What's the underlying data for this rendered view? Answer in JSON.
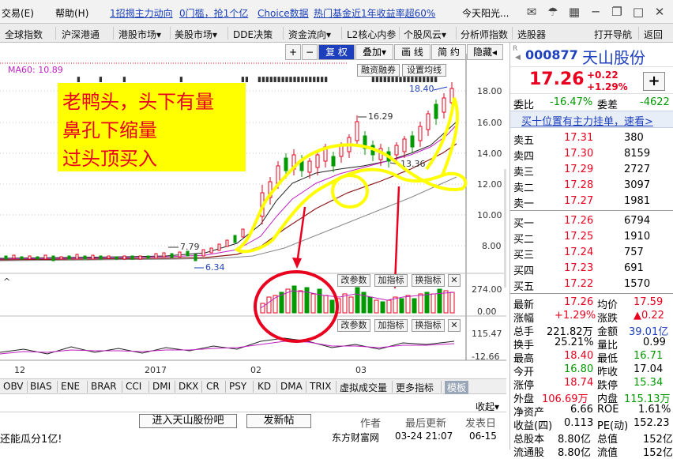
{
  "topbar": {
    "menu_trade": "交易(E)",
    "menu_help": "帮助(H)",
    "links": [
      "1招揭主力动向",
      "0门槛，抢1个亿",
      "Choice数据",
      "热门基金近1年收益率超60%"
    ],
    "weather": "今天阳光..."
  },
  "navbar": {
    "items": [
      "全球指数",
      "沪深港通",
      "港股市场▾",
      "美股市场▾",
      "DDE决策",
      "资金流向▾",
      "L2核心内参",
      "个股风云▾",
      "分析师指数",
      "选股器",
      "打开导航",
      "返回"
    ]
  },
  "chart": {
    "ma_label": "MA60: 10.89",
    "toolbar": [
      "+",
      "−",
      "复 权",
      "叠加▾",
      "画 线",
      "简 约",
      "隐藏◂"
    ],
    "buttons": [
      "融资融券",
      "设置均线"
    ],
    "annotation_lines": [
      "老鸭头，头下有量",
      "鼻孔下缩量",
      "过头顶买入"
    ],
    "price_axis": [
      "18.00",
      "16.00",
      "14.00",
      "12.00",
      "10.00",
      "8.00"
    ],
    "marks": {
      "high": "18.40",
      "p1629": "16.29",
      "p1336": "13.36",
      "p779": "7.79",
      "low": "6.34"
    },
    "indicator_buttons": [
      "改参数",
      "加指标",
      "换指标"
    ],
    "volume_axis": [
      "274.00",
      "0.00"
    ],
    "osc_axis": [
      "115.47",
      "-12.66"
    ],
    "date_labels": [
      "12",
      "2017",
      "02",
      "03"
    ]
  },
  "tabs": {
    "items": [
      "OBV",
      "BIAS",
      "ENE",
      "BRAR",
      "CCI",
      "DMI",
      "DKX",
      "CR",
      "PSY",
      "KD",
      "DMA",
      "TRIX",
      "虚拟成交量",
      "更多指标",
      "模板"
    ]
  },
  "news": {
    "collapse": "收起",
    "btn_forum": "进入天山股份吧",
    "btn_post": "发新帖",
    "headers": [
      "作者",
      "最后更新",
      "发表日"
    ],
    "row": {
      "title": "还能瓜分1亿!",
      "author": "东方财富网",
      "updated": "03-24 21:07",
      "date": "06-15"
    }
  },
  "quote": {
    "code": "000877",
    "name": "天山股份",
    "price": "17.26",
    "change": "+0.22",
    "change_pct": "+1.29%",
    "weibi_label": "委比",
    "weibi": "-16.47%",
    "weicha_label": "委差",
    "weicha": "-4622",
    "banner": "买十位置有主力挂单，速看>",
    "asks": [
      {
        "label": "卖五",
        "price": "17.31",
        "vol": "380"
      },
      {
        "label": "卖四",
        "price": "17.30",
        "vol": "8159"
      },
      {
        "label": "卖三",
        "price": "17.29",
        "vol": "2727"
      },
      {
        "label": "卖二",
        "price": "17.28",
        "vol": "3097"
      },
      {
        "label": "卖一",
        "price": "17.27",
        "vol": "1981"
      }
    ],
    "bids": [
      {
        "label": "买一",
        "price": "17.26",
        "vol": "6794"
      },
      {
        "label": "买二",
        "price": "17.25",
        "vol": "1910"
      },
      {
        "label": "买三",
        "price": "17.24",
        "vol": "757"
      },
      {
        "label": "买四",
        "price": "17.23",
        "vol": "691"
      },
      {
        "label": "买五",
        "price": "17.22",
        "vol": "1570"
      }
    ],
    "stats": [
      {
        "l1": "最新",
        "v1": "17.26",
        "c1": "red",
        "l2": "均价",
        "v2": "17.59",
        "c2": "red"
      },
      {
        "l1": "涨幅",
        "v1": "+1.29%",
        "c1": "red",
        "l2": "涨跌",
        "v2": "▲0.22",
        "c2": "red"
      },
      {
        "l1": "总手",
        "v1": "221.82万",
        "c1": "dk",
        "l2": "金额",
        "v2": "39.01亿",
        "c2": "blue"
      },
      {
        "l1": "换手",
        "v1": "25.21%",
        "c1": "dk",
        "l2": "量比",
        "v2": "0.99",
        "c2": "dk"
      },
      {
        "l1": "最高",
        "v1": "18.40",
        "c1": "red",
        "l2": "最低",
        "v2": "16.71",
        "c2": "green"
      },
      {
        "l1": "今开",
        "v1": "16.80",
        "c1": "green",
        "l2": "昨收",
        "v2": "17.04",
        "c2": "dk"
      },
      {
        "l1": "涨停",
        "v1": "18.74",
        "c1": "red",
        "l2": "跌停",
        "v2": "15.34",
        "c2": "green"
      },
      {
        "l1": "外盘",
        "v1": "106.69万",
        "c1": "red",
        "l2": "内盘",
        "v2": "115.13万",
        "c2": "green"
      },
      {
        "l1": "净资产",
        "v1": "6.66",
        "c1": "dk",
        "l2": "ROE",
        "v2": "1.61%",
        "c2": "dk"
      },
      {
        "l1": "收益(四)",
        "v1": "0.113",
        "c1": "dk",
        "l2": "PE(动)",
        "v2": "152.23",
        "c2": "dk"
      },
      {
        "l1": "总股本",
        "v1": "8.80亿",
        "c1": "dk",
        "l2": "总值",
        "v2": "152亿",
        "c2": "dk"
      },
      {
        "l1": "流通股",
        "v1": "8.80亿",
        "c1": "dk",
        "l2": "流值",
        "v2": "152亿",
        "c2": "dk"
      }
    ]
  },
  "colors": {
    "up": "#e8001e",
    "down": "#009900",
    "accent": "#1d3fbd",
    "annotation_bg": "#ffff00"
  }
}
